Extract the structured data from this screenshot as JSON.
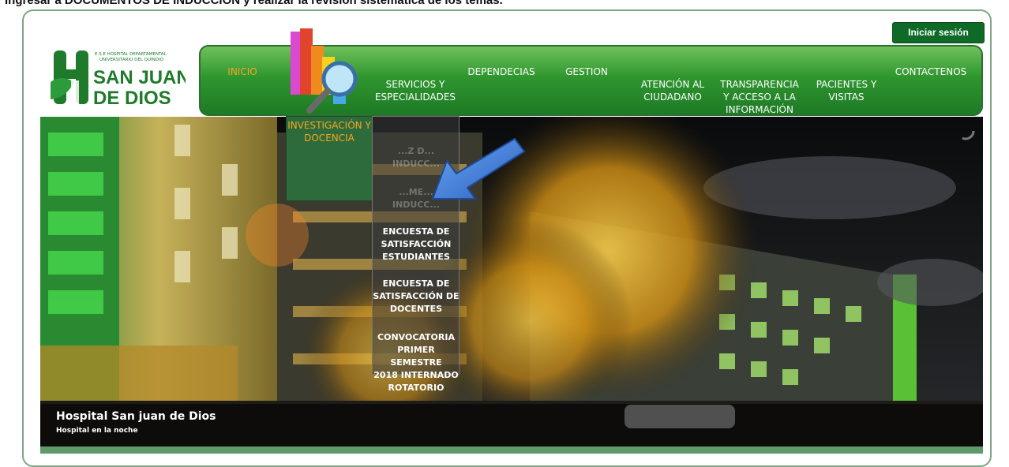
{
  "instruction": "Ingresar a DOCUMENTOS DE INDUCCIÓN y realizar la revisión sistemática de los temas.",
  "header": {
    "login_label": "Iniciar sesión",
    "logo": {
      "line1": "E.S.E HOSPITAL DEPARTAMENTAL",
      "line2": "UNIVERSITARIO DEL QUINDIO",
      "name1": "SAN JUAN",
      "name2": "DE DIOS"
    }
  },
  "nav": {
    "items": [
      {
        "label": "INICIO",
        "active": true
      },
      {
        "label": "SERVICIOS Y\nESPECIALIDADES"
      },
      {
        "label": "DEPENDECIAS"
      },
      {
        "label": "GESTION"
      },
      {
        "label": "ATENCIÓN AL\nCIUDADANO"
      },
      {
        "label": "TRANSPARENCIA\nY ACCESO A LA\nINFORMACIÓN"
      },
      {
        "label": "PACIENTES Y\nVISITAS"
      },
      {
        "label": "CONTACTENOS"
      }
    ],
    "open_menu": "INVESTIGACIÓN Y\nDOCENCIA",
    "submenu": [
      {
        "label": "...Z D...\nINDUCC..."
      },
      {
        "label": "...ME...\nINDUCC..."
      },
      {
        "label": "ENCUESTA DE\nSATISFACCIÓN\nESTUDIANTES"
      },
      {
        "label": "ENCUESTA DE\nSATISFACCIÓN DE\nDOCENTES"
      },
      {
        "label": "CONVOCATORIA\nPRIMER SEMESTRE\n2018 INTERNADO\nROTATORIO"
      }
    ]
  },
  "slider": {
    "caption_title": "Hospital San juan de Dios",
    "caption_subtitle": "Hospital en la noche"
  },
  "colors": {
    "nav_green": "#2f962f",
    "active_orange": "#f5a623",
    "login_green": "#0e6a26",
    "frame_border": "#7fa487"
  },
  "icons": [
    "investigation-chart-icon",
    "loading-spinner-icon",
    "pointer-arrow-icon"
  ]
}
